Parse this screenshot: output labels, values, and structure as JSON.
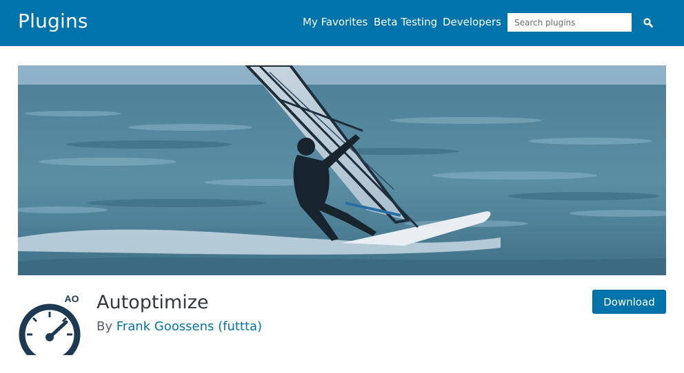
{
  "header": {
    "site_title": "Plugins",
    "nav": [
      {
        "label": "My Favorites"
      },
      {
        "label": "Beta Testing"
      },
      {
        "label": "Developers"
      }
    ],
    "search_placeholder": "Search plugins",
    "search_icon": "search-icon"
  },
  "plugin": {
    "name": "Autoptimize",
    "byline_prefix": "By",
    "author": "Frank Goossens (futtta)",
    "download_label": "Download",
    "icon_text": "AO"
  },
  "colors": {
    "brand": "#0073aa",
    "title_text": "#32373c",
    "icon_navy": "#1e3a52"
  }
}
